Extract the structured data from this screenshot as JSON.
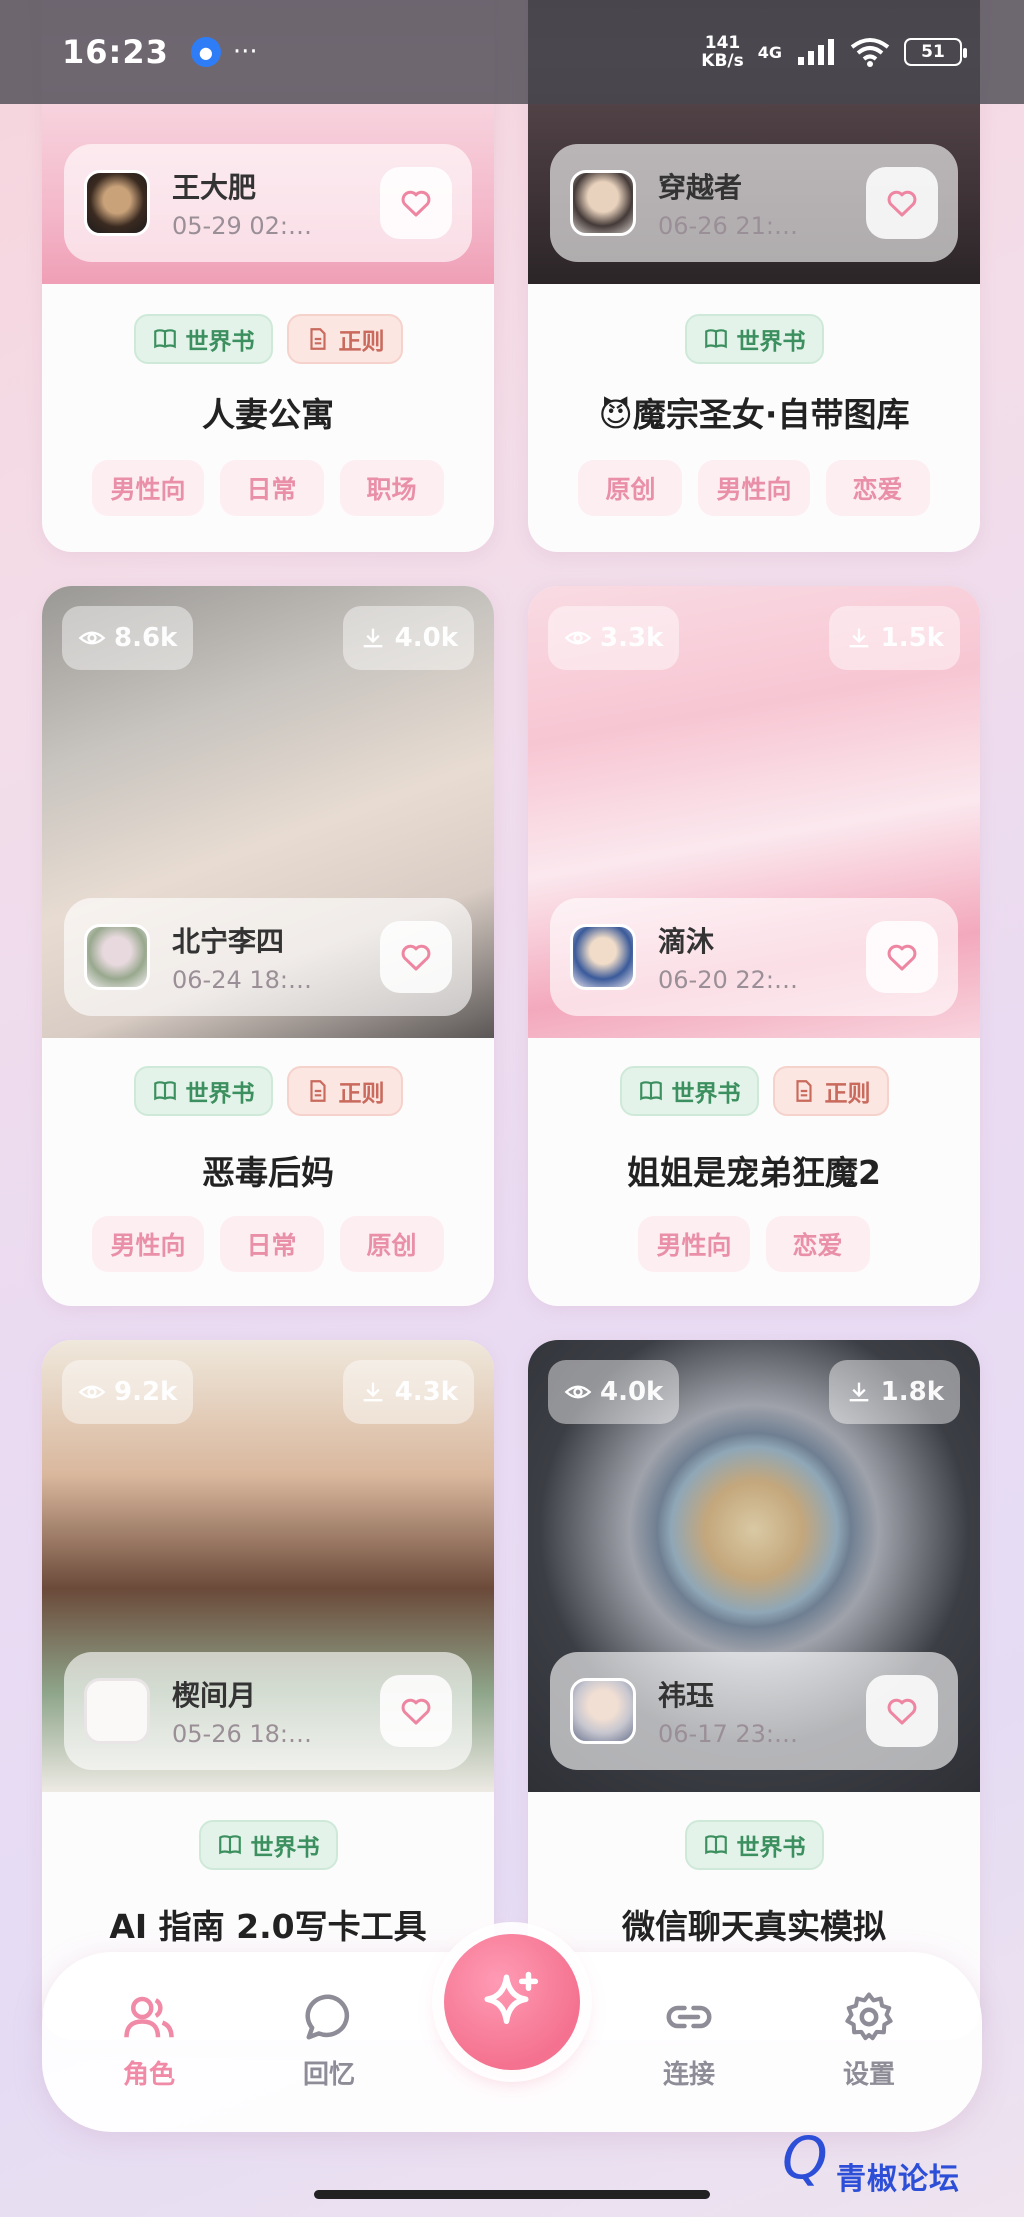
{
  "status_bar": {
    "time": "16:23",
    "more": "···",
    "speed_value": "141",
    "speed_unit": "KB/s",
    "network": "4G",
    "battery": "51"
  },
  "cards": [
    {
      "author": "王大肥",
      "date": "05-29 02:…",
      "badges": [
        "世界书",
        "正则"
      ],
      "title": "人妻公寓",
      "tags": [
        "男性向",
        "日常",
        "职场"
      ]
    },
    {
      "author": "穿越者",
      "date": "06-26 21:…",
      "badges": [
        "世界书"
      ],
      "title": "😈魔宗圣女·自带图库",
      "tags": [
        "原创",
        "男性向",
        "恋爱"
      ]
    },
    {
      "views": "8.6k",
      "downloads": "4.0k",
      "author": "北宁李四",
      "date": "06-24 18:…",
      "badges": [
        "世界书",
        "正则"
      ],
      "title": "恶毒后妈",
      "tags": [
        "男性向",
        "日常",
        "原创"
      ]
    },
    {
      "views": "3.3k",
      "downloads": "1.5k",
      "author": "滴沐",
      "date": "06-20 22:…",
      "badges": [
        "世界书",
        "正则"
      ],
      "title": "姐姐是宠弟狂魔2",
      "tags": [
        "男性向",
        "恋爱"
      ]
    },
    {
      "views": "9.2k",
      "downloads": "4.3k",
      "author": "楔间月",
      "date": "05-26 18:…",
      "badges": [
        "世界书"
      ],
      "title": "AI 指南 2.0写卡工具",
      "tags": []
    },
    {
      "views": "4.0k",
      "downloads": "1.8k",
      "author": "祎珏",
      "date": "06-17 23:…",
      "badges": [
        "世界书"
      ],
      "title": "微信聊天真实模拟",
      "tags": []
    }
  ],
  "nav": {
    "items": [
      "角色",
      "回忆",
      "连接",
      "设置"
    ],
    "active_color": "#f08aa6"
  },
  "watermark": {
    "q": "Q",
    "text": "青椒论坛"
  }
}
